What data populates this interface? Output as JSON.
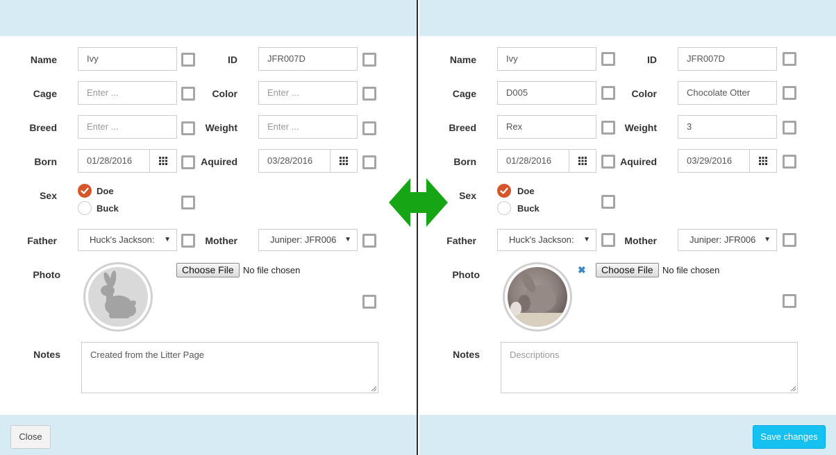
{
  "labels": {
    "name": "Name",
    "id": "ID",
    "cage": "Cage",
    "color": "Color",
    "breed": "Breed",
    "weight": "Weight",
    "born": "Born",
    "aquired": "Aquired",
    "sex": "Sex",
    "father": "Father",
    "mother": "Mother",
    "photo": "Photo",
    "notes": "Notes"
  },
  "sex_options": [
    "Doe",
    "Buck"
  ],
  "file_input": {
    "button": "Choose File",
    "status": "No file chosen"
  },
  "left": {
    "name": "Ivy",
    "id": "JFR007D",
    "cage": "Enter ...",
    "color": "Enter ...",
    "breed": "Enter ...",
    "weight": "Enter ...",
    "born": "01/28/2016",
    "aquired": "03/28/2016",
    "sex_selected": "Doe",
    "father": "Huck's Jackson:",
    "mother": "Juniper: JFR006",
    "photo": "rabbit-silhouette-icon",
    "notes": "Created from the Litter Page",
    "close_label": "Close"
  },
  "right": {
    "name": "Ivy",
    "id": "JFR007D",
    "cage": "D005",
    "color": "Chocolate Otter",
    "breed": "Rex",
    "weight": "3",
    "born": "01/28/2016",
    "aquired": "03/29/2016",
    "sex_selected": "Doe",
    "father": "Huck's Jackson:",
    "mother": "Juniper: JFR006",
    "photo": "rabbit-photo",
    "notes_placeholder": "Descriptions",
    "remove_photo_icon": "remove-icon",
    "save_label": "Save changes"
  },
  "colors": {
    "header_bg": "#d7ebf5",
    "radio_checked": "#d6562b",
    "compare_arrow": "#15a515",
    "save_button": "#14c1f0"
  }
}
